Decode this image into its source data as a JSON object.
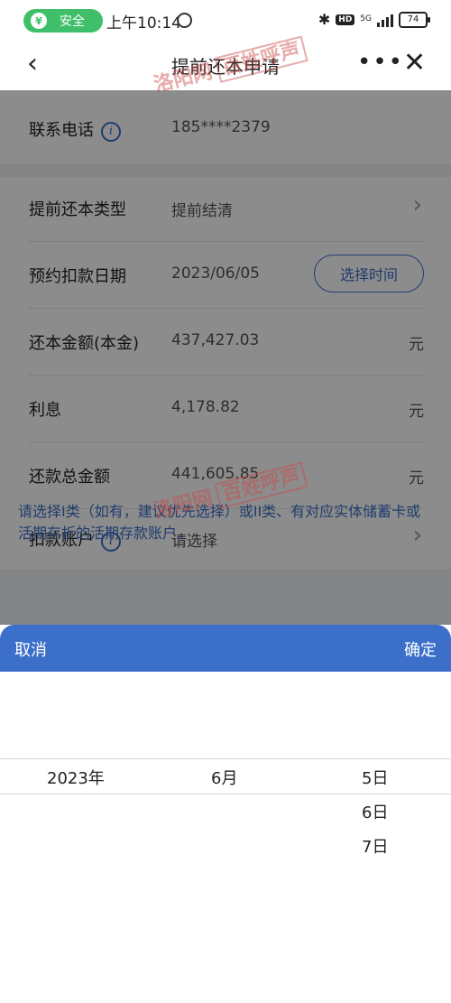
{
  "status_bar": {
    "safe_label": "安全",
    "time": "上午10:14",
    "net": "5G",
    "hd": "HD",
    "battery": "74"
  },
  "nav": {
    "title": "提前还本申请"
  },
  "form": {
    "phone": {
      "label": "联系电话",
      "value": "185****2379"
    },
    "type": {
      "label": "提前还本类型",
      "value": "提前结清"
    },
    "date": {
      "label": "预约扣款日期",
      "value": "2023/06/05",
      "button": "选择时间"
    },
    "principal": {
      "label": "还本金额(本金)",
      "value": "437,427.03",
      "unit": "元"
    },
    "interest": {
      "label": "利息",
      "value": "4,178.82",
      "unit": "元"
    },
    "total": {
      "label": "还款总金额",
      "value": "441,605.85",
      "unit": "元"
    },
    "account": {
      "label": "扣款账户",
      "value": "请选择"
    }
  },
  "notice": "请选择I类（如有，建议优先选择）或II类、有对应实体储蓄卡或活期存折的活期存款账户。",
  "watermark": {
    "site": "洛阳网",
    "brand": "百姓呼声"
  },
  "picker": {
    "cancel": "取消",
    "confirm": "确定",
    "years": [
      "2023年"
    ],
    "months": [
      "6月"
    ],
    "days": [
      "5日",
      "6日",
      "7日"
    ],
    "selected": {
      "year": "2023年",
      "month": "6月",
      "day": "5日"
    }
  },
  "colors": {
    "accent": "#3b6fc9",
    "safe_green": "#3fbf6a",
    "watermark": "#cd4646"
  }
}
